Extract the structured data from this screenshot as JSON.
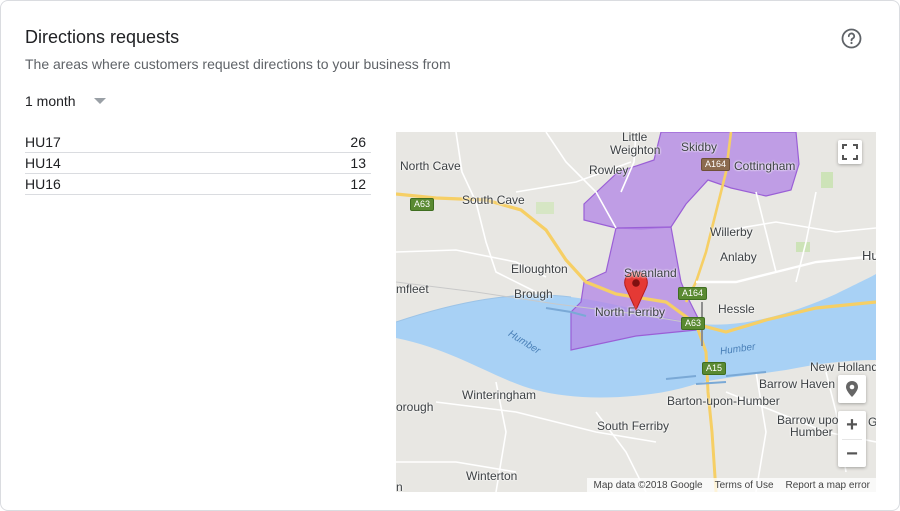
{
  "header": {
    "title": "Directions requests",
    "subtitle": "The areas where customers request directions to your business from",
    "help_icon": "help-circle-icon"
  },
  "filter": {
    "period_label": "1 month",
    "dropdown_icon": "caret-down-icon"
  },
  "postcodes": [
    {
      "code": "HU17",
      "count": "26"
    },
    {
      "code": "HU14",
      "count": "13"
    },
    {
      "code": "HU16",
      "count": "12"
    }
  ],
  "map": {
    "places": {
      "little_weighton_1": "Little",
      "little_weighton_2": "Weighton",
      "skidby": "Skidby",
      "cottingham": "Cottingham",
      "north_cave": "North Cave",
      "rowley": "Rowley",
      "south_cave": "South Cave",
      "willerby": "Willerby",
      "anlaby": "Anlaby",
      "hull_partial": "Hu",
      "elloughton": "Elloughton",
      "swanland": "Swanland",
      "brough": "Brough",
      "newport_partial": "mfleet",
      "north_ferriby": "North Ferriby",
      "hessle": "Hessle",
      "new_holland": "New Holland",
      "barrow_haven": "Barrow Haven",
      "winteringham": "Winteringham",
      "barton": "Barton-upon-Humber",
      "scunthorpe_partial": "orough",
      "barrow_upon_humber_1": "Barrow upo",
      "barrow_upon_humber_2": "Humber",
      "goxhill_partial": "G",
      "south_ferriby": "South Ferriby",
      "winterton": "Winterton",
      "bottom_partial": "n"
    },
    "water_labels": {
      "humber_west": "Humber",
      "humber_east": "Humber"
    },
    "road_shields": {
      "a63_west": "A63",
      "a164_north": "A164",
      "a164_south": "A164",
      "a63_east": "A63",
      "a15": "A15"
    },
    "colors": {
      "region_fill": "#b388e6",
      "region_stroke": "#9a5fd6",
      "water": "#a8d1f5",
      "marker": "#e53935"
    },
    "controls": {
      "fullscreen_icon": "fullscreen-icon",
      "pegman_icon": "place-marker-icon",
      "zoom_in_label": "+",
      "zoom_out_label": "−"
    },
    "attribution": {
      "map_data": "Map data ©2018 Google",
      "terms": "Terms of Use",
      "report": "Report a map error"
    }
  }
}
